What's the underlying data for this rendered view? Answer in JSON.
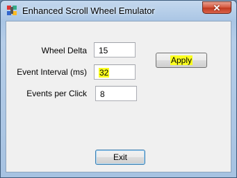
{
  "window": {
    "title": "Enhanced Scroll Wheel Emulator",
    "close_glyph": "✕"
  },
  "fields": [
    {
      "label": "Wheel Delta",
      "value": "15"
    },
    {
      "label": "Event Interval (ms)",
      "value": "32"
    },
    {
      "label": "Events per Click",
      "value": "8"
    }
  ],
  "buttons": {
    "apply": "Apply",
    "exit": "Exit"
  },
  "colors": {
    "highlight": "#fbff1f",
    "close_button": "#c0391f"
  }
}
